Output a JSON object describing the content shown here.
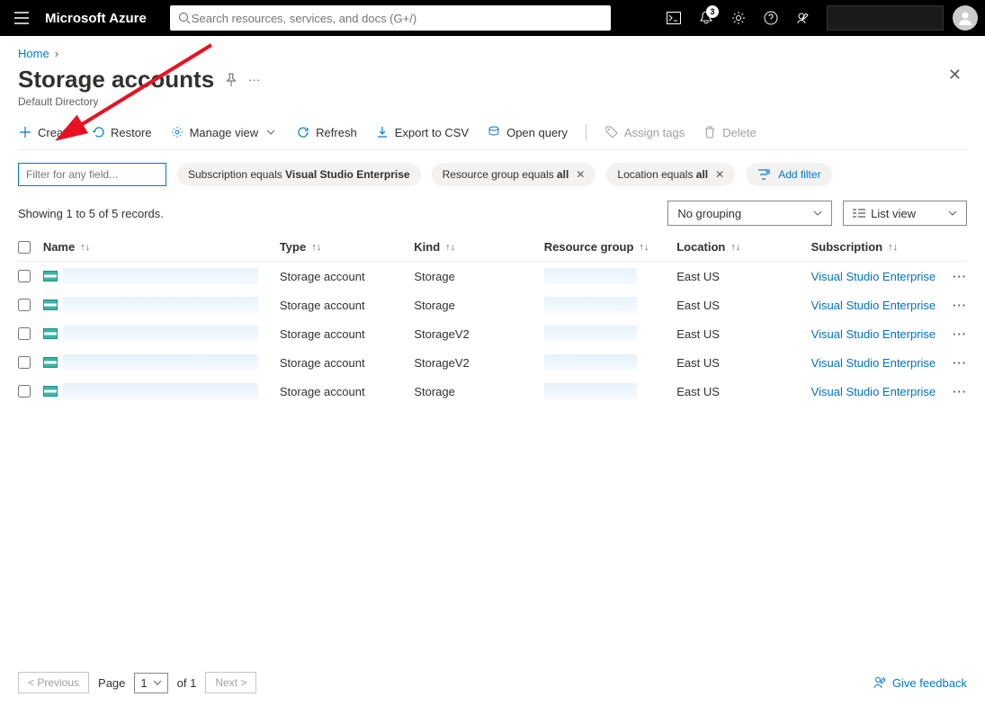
{
  "topbar": {
    "brand": "Microsoft Azure",
    "search_placeholder": "Search resources, services, and docs (G+/)",
    "notification_count": "3"
  },
  "breadcrumb": {
    "home": "Home"
  },
  "page": {
    "title": "Storage accounts",
    "subtitle": "Default Directory"
  },
  "toolbar": {
    "create": "Create",
    "restore": "Restore",
    "manage_view": "Manage view",
    "refresh": "Refresh",
    "export_csv": "Export to CSV",
    "open_query": "Open query",
    "assign_tags": "Assign tags",
    "delete": "Delete"
  },
  "filters": {
    "placeholder": "Filter for any field...",
    "sub_pre": "Subscription equals ",
    "sub_val": "Visual Studio Enterprise",
    "rg_pre": "Resource group equals ",
    "rg_val": "all",
    "loc_pre": "Location equals ",
    "loc_val": "all",
    "add": "Add filter"
  },
  "records": {
    "text": "Showing 1 to 5 of 5 records.",
    "grouping": "No grouping",
    "view": "List view"
  },
  "columns": {
    "name": "Name",
    "type": "Type",
    "kind": "Kind",
    "rg": "Resource group",
    "loc": "Location",
    "sub": "Subscription"
  },
  "rows": [
    {
      "type": "Storage account",
      "kind": "Storage",
      "loc": "East US",
      "sub": "Visual Studio Enterprise"
    },
    {
      "type": "Storage account",
      "kind": "Storage",
      "loc": "East US",
      "sub": "Visual Studio Enterprise"
    },
    {
      "type": "Storage account",
      "kind": "StorageV2",
      "loc": "East US",
      "sub": "Visual Studio Enterprise"
    },
    {
      "type": "Storage account",
      "kind": "StorageV2",
      "loc": "East US",
      "sub": "Visual Studio Enterprise"
    },
    {
      "type": "Storage account",
      "kind": "Storage",
      "loc": "East US",
      "sub": "Visual Studio Enterprise"
    }
  ],
  "footer": {
    "prev": "< Previous",
    "page_label": "Page",
    "page_num": "1",
    "of": "of 1",
    "next": "Next >",
    "feedback": "Give feedback"
  }
}
